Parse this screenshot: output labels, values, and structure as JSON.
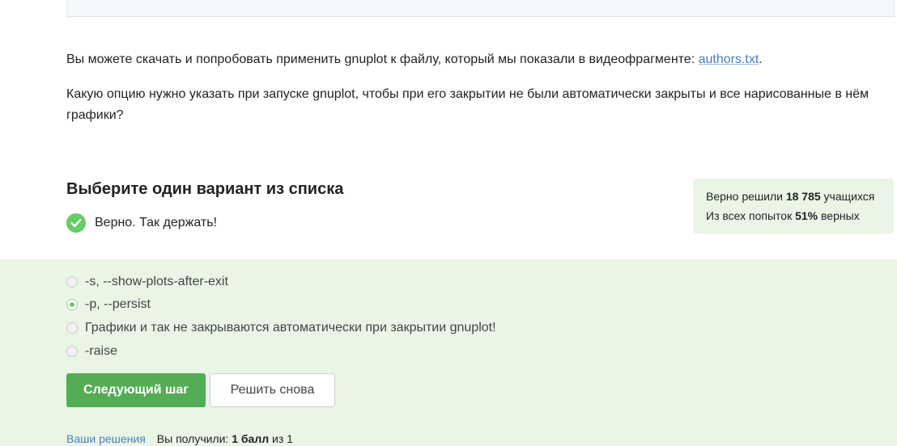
{
  "intro": {
    "text_before_link": "Вы можете скачать и попробовать применить gnuplot к файлу, который мы показали в видеофрагменте: ",
    "link_text": "authors.txt",
    "text_after_link": "."
  },
  "question": "Какую опцию нужно указать при запуске gnuplot, чтобы при его закрытии не были автоматически закрыты и все нарисованные в нём графики?",
  "heading": "Выберите один вариант из списка",
  "feedback": "Верно. Так держать!",
  "stats": {
    "solved_prefix": "Верно решили ",
    "solved_count": "18 785",
    "solved_suffix": " учащихся",
    "attempts_prefix": "Из всех попыток ",
    "attempts_percent": "51%",
    "attempts_suffix": " верных"
  },
  "options": [
    {
      "label": "-s, --show-plots-after-exit",
      "selected": false
    },
    {
      "label": "-p, --persist",
      "selected": true
    },
    {
      "label": "Графики и так не закрываются автоматически при закрытии gnuplot!",
      "selected": false
    },
    {
      "label": "-raise",
      "selected": false
    }
  ],
  "buttons": {
    "next": "Следующий шаг",
    "retry": "Решить снова"
  },
  "footer": {
    "solutions_link": "Ваши решения",
    "score_prefix": "Вы получили: ",
    "score_value": "1 балл",
    "score_suffix": " из 1"
  },
  "colors": {
    "accent_green": "#54ad54",
    "check_green": "#66cc66",
    "answer_bg": "#e9f6e6",
    "link": "#4a7dbf"
  }
}
